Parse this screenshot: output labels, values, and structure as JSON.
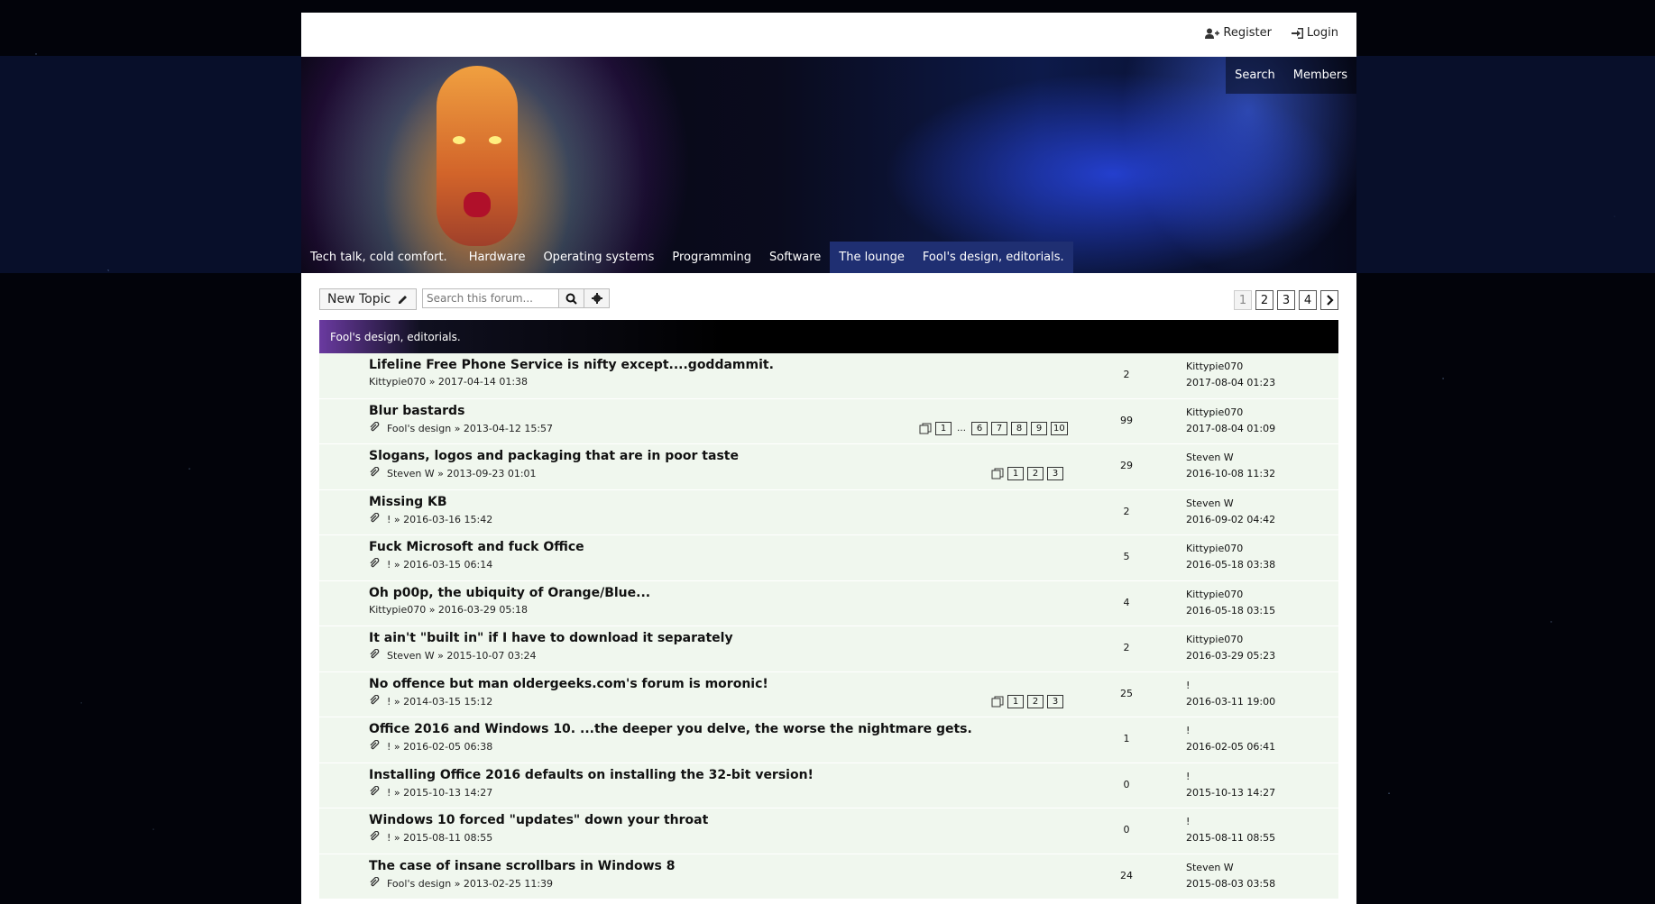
{
  "top": {
    "register": "Register",
    "login": "Login"
  },
  "banner_links": {
    "search": "Search",
    "members": "Members"
  },
  "nav": [
    {
      "label": "Tech talk, cold comfort."
    },
    {
      "label": "Hardware"
    },
    {
      "label": "Operating systems"
    },
    {
      "label": "Programming"
    },
    {
      "label": "Software"
    },
    {
      "label": "The lounge"
    },
    {
      "label": "Fool's design, editorials."
    }
  ],
  "actions": {
    "new_topic": "New Topic",
    "search_placeholder": "Search this forum..."
  },
  "pagination": [
    "1",
    "2",
    "3",
    "4"
  ],
  "forum_title": "Fool's design, editorials.",
  "topics": [
    {
      "title": "Lifeline Free Phone Service is nifty except....goddammit.",
      "meta": "Kittypie070 » 2017-04-14 01:38",
      "replies": "2",
      "last_user": "Kittypie070",
      "last_date": "2017-08-04 01:23"
    },
    {
      "title": "Blur bastards",
      "meta": "Fool's design » 2013-04-12 15:57",
      "replies": "99",
      "last_user": "Kittypie070",
      "last_date": "2017-08-04 01:09",
      "pages": [
        "1",
        "6",
        "7",
        "8",
        "9",
        "10"
      ]
    },
    {
      "title": "Slogans, logos and packaging that are in poor taste",
      "meta": "Steven W » 2013-09-23 01:01",
      "replies": "29",
      "last_user": "Steven W",
      "last_date": "2016-10-08 11:32",
      "pages": [
        "1",
        "2",
        "3"
      ]
    },
    {
      "title": "Missing KB",
      "meta": "! » 2016-03-16 15:42",
      "replies": "2",
      "last_user": "Steven W",
      "last_date": "2016-09-02 04:42"
    },
    {
      "title": "Fuck Microsoft and fuck Office",
      "meta": "! » 2016-03-15 06:14",
      "replies": "5",
      "last_user": "Kittypie070",
      "last_date": "2016-05-18 03:38"
    },
    {
      "title": "Oh p00p, the ubiquity of Orange/Blue...",
      "meta": "Kittypie070 » 2016-03-29 05:18",
      "replies": "4",
      "last_user": "Kittypie070",
      "last_date": "2016-05-18 03:15"
    },
    {
      "title": "It ain't \"built in\" if I have to download it separately",
      "meta": "Steven W » 2015-10-07 03:24",
      "replies": "2",
      "last_user": "Kittypie070",
      "last_date": "2016-03-29 05:23"
    },
    {
      "title": "No offence but man oldergeeks.com's forum is moronic!",
      "meta": "! » 2014-03-15 15:12",
      "replies": "25",
      "last_user": "!",
      "last_date": "2016-03-11 19:00",
      "pages": [
        "1",
        "2",
        "3"
      ]
    },
    {
      "title": "Office 2016 and Windows 10. ...the deeper you delve, the worse the nightmare gets.",
      "meta": "! » 2016-02-05 06:38",
      "replies": "1",
      "last_user": "!",
      "last_date": "2016-02-05 06:41"
    },
    {
      "title": "Installing Office 2016 defaults on installing the 32-bit version!",
      "meta": "! » 2015-10-13 14:27",
      "replies": "0",
      "last_user": "!",
      "last_date": "2015-10-13 14:27"
    },
    {
      "title": "Windows 10 forced \"updates\" down your throat",
      "meta": "! » 2015-08-11 08:55",
      "replies": "0",
      "last_user": "!",
      "last_date": "2015-08-11 08:55"
    },
    {
      "title": "The case of insane scrollbars in Windows 8",
      "meta": "Fool's design » 2013-02-25 11:39",
      "replies": "24",
      "last_user": "Steven W",
      "last_date": "2015-08-03 03:58"
    }
  ]
}
